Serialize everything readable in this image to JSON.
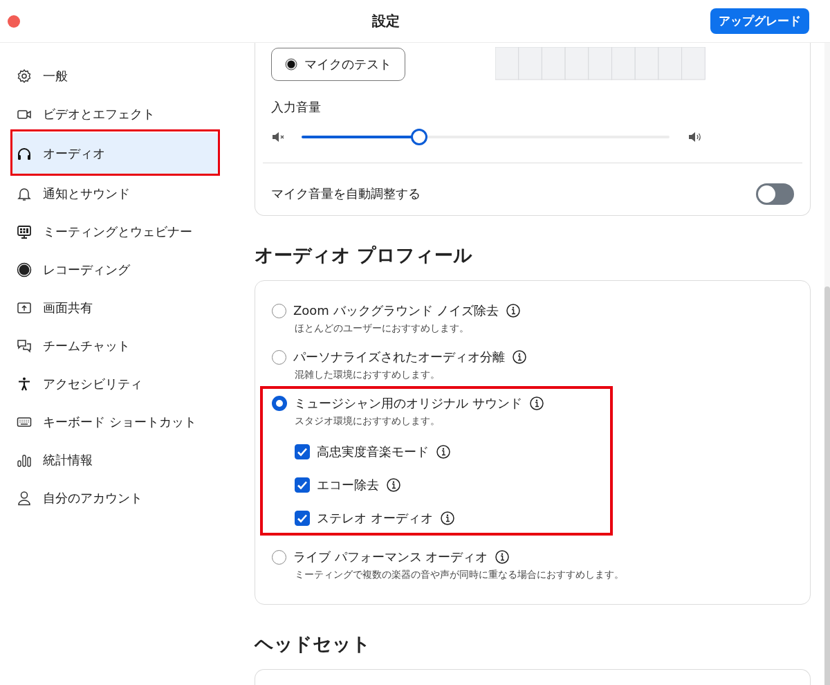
{
  "window": {
    "title": "設定",
    "upgrade_button": "アップグレード"
  },
  "sidebar": {
    "items": [
      {
        "label": "一般",
        "selected": false,
        "highlighted": false
      },
      {
        "label": "ビデオとエフェクト",
        "selected": false,
        "highlighted": false
      },
      {
        "label": "オーディオ",
        "selected": true,
        "highlighted": true
      },
      {
        "label": "通知とサウンド",
        "selected": false,
        "highlighted": false
      },
      {
        "label": "ミーティングとウェビナー",
        "selected": false,
        "highlighted": false
      },
      {
        "label": "レコーディング",
        "selected": false,
        "highlighted": false
      },
      {
        "label": "画面共有",
        "selected": false,
        "highlighted": false
      },
      {
        "label": "チームチャット",
        "selected": false,
        "highlighted": false
      },
      {
        "label": "アクセシビリティ",
        "selected": false,
        "highlighted": false
      },
      {
        "label": "キーボード ショートカット",
        "selected": false,
        "highlighted": false
      },
      {
        "label": "統計情報",
        "selected": false,
        "highlighted": false
      },
      {
        "label": "自分のアカウント",
        "selected": false,
        "highlighted": false
      }
    ]
  },
  "audio_input": {
    "mic_test_button": "マイクのテスト",
    "volume_label": "入力音量",
    "volume": {
      "level": 0.32
    },
    "auto_adjust": {
      "label": "マイク音量を自動調整する",
      "on": false
    }
  },
  "audio_profile": {
    "heading": "オーディオ プロフィール",
    "options": [
      {
        "label": "Zoom バックグラウンド ノイズ除去",
        "description": "ほとんどのユーザーにおすすめします。",
        "selected": false,
        "highlighted": false
      },
      {
        "label": "パーソナライズされたオーディオ分離",
        "description": "混雑した環境におすすめします。",
        "selected": false,
        "highlighted": false
      },
      {
        "label": "ミュージシャン用のオリジナル サウンド",
        "description": "スタジオ環境におすすめします。",
        "selected": true,
        "highlighted": true,
        "suboptions": [
          {
            "label": "高忠実度音楽モード",
            "checked": true
          },
          {
            "label": "エコー除去",
            "checked": true
          },
          {
            "label": "ステレオ オーディオ",
            "checked": true
          }
        ]
      },
      {
        "label": "ライブ パフォーマンス オーディオ",
        "description": "ミーティングで複数の楽器の音や声が同時に重なる場合におすすめします。",
        "selected": false,
        "highlighted": false
      }
    ]
  },
  "headset": {
    "heading": "ヘッドセット"
  }
}
